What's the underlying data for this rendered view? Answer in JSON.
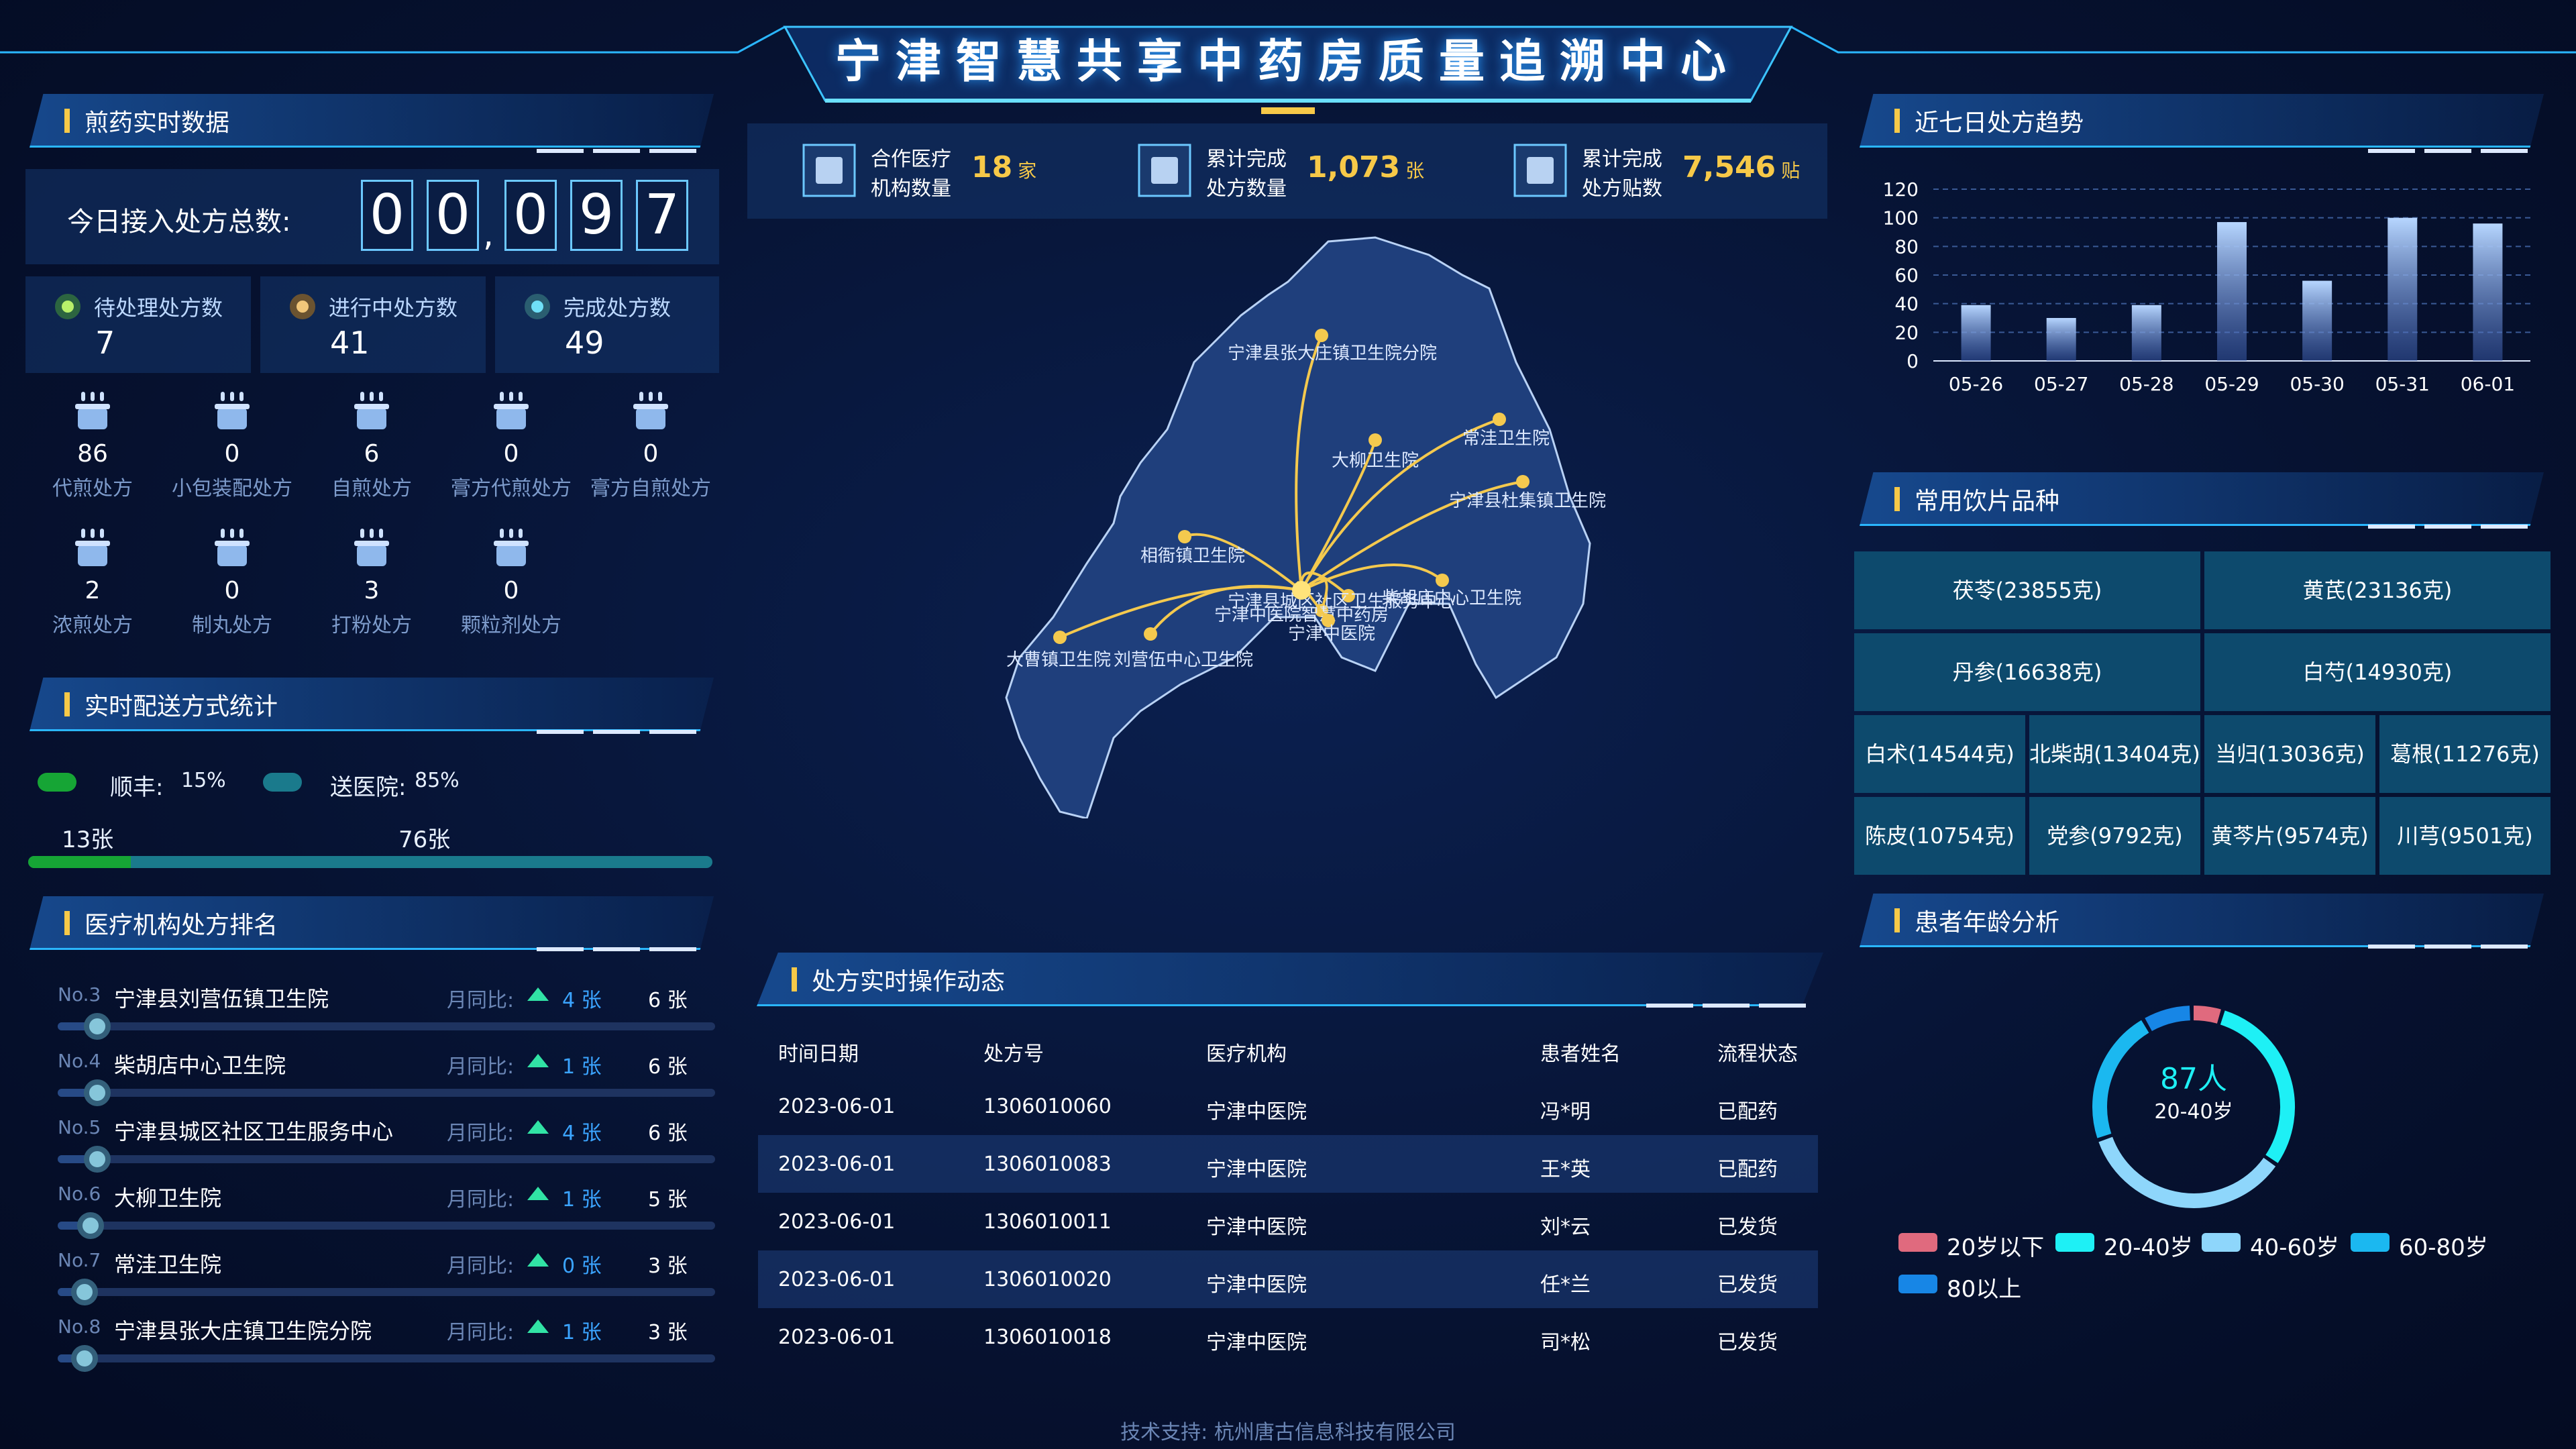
{
  "title": "宁津智慧共享中药房质量追溯中心",
  "footer": "技术支持: 杭州唐古信息科技有限公司",
  "colors": {
    "accent": "#2ab6ff",
    "gold": "#f7c948",
    "green": "#31e3a5"
  },
  "sections": {
    "decoction": "煎药实时数据",
    "delivery": "实时配送方式统计",
    "ranking": "医疗机构处方排名",
    "trend": "近七日处方趋势",
    "herbs": "常用饮片品种",
    "age": "患者年龄分析",
    "ops": "处方实时操作动态"
  },
  "today": {
    "label": "今日接入处方总数:",
    "digits": [
      "0",
      "0",
      "0",
      "9",
      "7"
    ],
    "sep": ","
  },
  "status": [
    {
      "label": "待处理处方数",
      "value": "7",
      "color": "#b8f06a"
    },
    {
      "label": "进行中处方数",
      "value": "41",
      "color": "#f2c77a"
    },
    {
      "label": "完成处方数",
      "value": "49",
      "color": "#6fe0f7"
    }
  ],
  "decoction_types": [
    {
      "label": "代煎处方",
      "value": "86",
      "icon": "decoction-pot-icon"
    },
    {
      "label": "小包装配处方",
      "value": "0",
      "icon": "package-icon"
    },
    {
      "label": "自煎处方",
      "value": "6",
      "icon": "decoction-pot-icon"
    },
    {
      "label": "膏方代煎处方",
      "value": "0",
      "icon": "paste-jar-icon"
    },
    {
      "label": "膏方自煎处方",
      "value": "0",
      "icon": "paste-jar-icon"
    },
    {
      "label": "浓煎处方",
      "value": "2",
      "icon": "concentrate-icon"
    },
    {
      "label": "制丸处方",
      "value": "0",
      "icon": "pill-pot-icon"
    },
    {
      "label": "打粉处方",
      "value": "3",
      "icon": "powder-pot-icon"
    },
    {
      "label": "颗粒剂处方",
      "value": "0",
      "icon": "granule-pot-icon"
    }
  ],
  "delivery": {
    "items": [
      {
        "label": "顺丰:",
        "pct": "15%",
        "color": "#16a535"
      },
      {
        "label": "送医院:",
        "pct": "85%",
        "color": "#1a7a8c"
      }
    ],
    "counts": [
      "13张",
      "76张"
    ],
    "share_first": 0.15
  },
  "ranking": [
    {
      "no": "No.3",
      "name": "宁津县刘营伍镇卫生院",
      "yoy": "月同比:",
      "inc": "4",
      "unit": "张",
      "total": "6 张",
      "level": 0.06
    },
    {
      "no": "No.4",
      "name": "柴胡店中心卫生院",
      "yoy": "月同比:",
      "inc": "1",
      "unit": "张",
      "total": "6 张",
      "level": 0.06
    },
    {
      "no": "No.5",
      "name": "宁津县城区社区卫生服务中心",
      "yoy": "月同比:",
      "inc": "4",
      "unit": "张",
      "total": "6 张",
      "level": 0.06
    },
    {
      "no": "No.6",
      "name": "大柳卫生院",
      "yoy": "月同比:",
      "inc": "1",
      "unit": "张",
      "total": "5 张",
      "level": 0.05
    },
    {
      "no": "No.7",
      "name": "常洼卫生院",
      "yoy": "月同比:",
      "inc": "0",
      "unit": "张",
      "total": "3 张",
      "level": 0.03
    },
    {
      "no": "No.8",
      "name": "宁津县张大庄镇卫生院分院",
      "yoy": "月同比:",
      "inc": "1",
      "unit": "张",
      "total": "3 张",
      "level": 0.03
    }
  ],
  "kpis": [
    {
      "l1": "合作医疗",
      "l2": "机构数量",
      "value": "18",
      "unit": "家",
      "icon": "hospital-cross-icon"
    },
    {
      "l1": "累计完成",
      "l2": "处方数量",
      "value": "1,073",
      "unit": "张",
      "icon": "prescription-icon"
    },
    {
      "l1": "累计完成",
      "l2": "处方贴数",
      "value": "7,546",
      "unit": "贴",
      "icon": "calendar-icon"
    }
  ],
  "map": {
    "hub": "宁津中医院",
    "sites": [
      "宁津县张大庄镇卫生院分院",
      "大柳卫生院",
      "常洼卫生院",
      "宁津县杜集镇卫生院",
      "相衙镇卫生院",
      "柴胡店中心卫生院",
      "宁津县城区社区卫生服务中心",
      "宁津中医院智慧中药房",
      "宁津中医院",
      "大曹镇卫生院",
      "刘营伍中心卫生院"
    ]
  },
  "chart_data": {
    "type": "bar",
    "categories": [
      "05-26",
      "05-27",
      "05-28",
      "05-29",
      "05-30",
      "05-31",
      "06-01"
    ],
    "values": [
      39,
      30,
      39,
      97,
      56,
      100,
      96
    ],
    "ylim": [
      0,
      120
    ],
    "yticks": [
      "0",
      "20",
      "40",
      "60",
      "80",
      "100",
      "120"
    ],
    "grid": true
  },
  "herbs": [
    "茯苓(23855克)",
    "黄芪(23136克)",
    "丹参(16638克)",
    "白芍(14930克)",
    "白术(14544克)",
    "北柴胡(13404克)",
    "当归(13036克)",
    "葛根(11276克)",
    "陈皮(10754克)",
    "党参(9792克)",
    "黄芩片(9574克)",
    "川芎(9501克)"
  ],
  "age": {
    "center_value": "87人",
    "center_label": "20-40岁",
    "groups": [
      {
        "label": "20岁以下",
        "color": "#e06a7e",
        "share": 0.05
      },
      {
        "label": "20-40岁",
        "color": "#1ef0f5",
        "share": 0.3
      },
      {
        "label": "40-60岁",
        "color": "#8ed6fb",
        "share": 0.35
      },
      {
        "label": "60-80岁",
        "color": "#1bb8f0",
        "share": 0.22
      },
      {
        "label": "80以上",
        "color": "#1786e6",
        "share": 0.08
      }
    ]
  },
  "ops": {
    "headers": [
      "时间日期",
      "处方号",
      "医疗机构",
      "患者姓名",
      "流程状态"
    ],
    "rows": [
      [
        "2023-06-01",
        "1306010060",
        "宁津中医院",
        "冯*明",
        "已配药"
      ],
      [
        "2023-06-01",
        "1306010083",
        "宁津中医院",
        "王*英",
        "已配药"
      ],
      [
        "2023-06-01",
        "1306010011",
        "宁津中医院",
        "刘*云",
        "已发货"
      ],
      [
        "2023-06-01",
        "1306010020",
        "宁津中医院",
        "任*兰",
        "已发货"
      ],
      [
        "2023-06-01",
        "1306010018",
        "宁津中医院",
        "司*松",
        "已发货"
      ]
    ]
  }
}
